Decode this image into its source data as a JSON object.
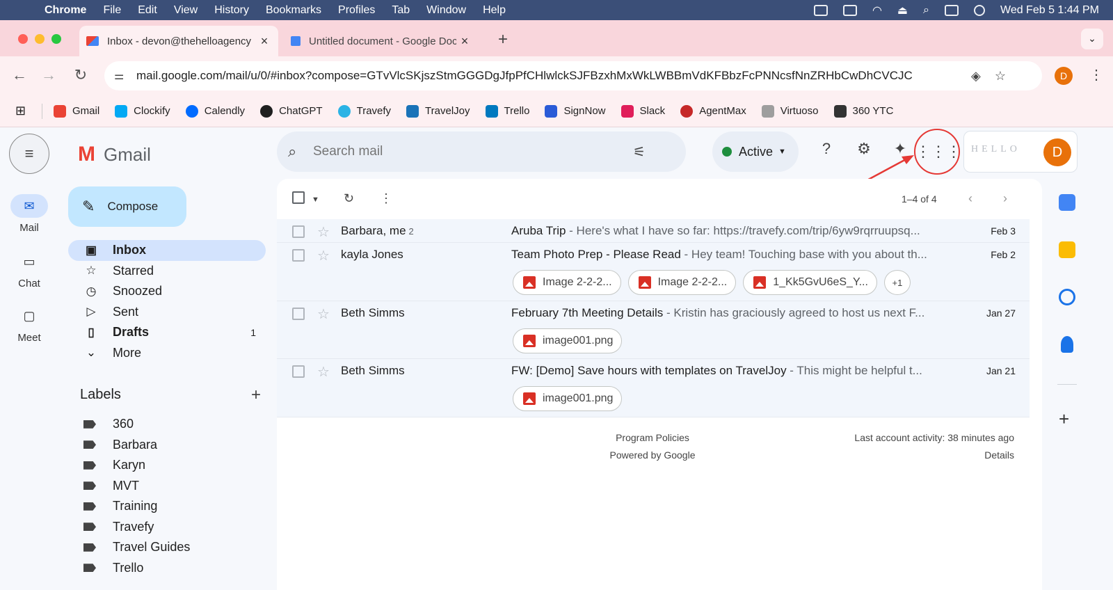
{
  "macos": {
    "app": "Chrome",
    "menus": [
      "File",
      "Edit",
      "View",
      "History",
      "Bookmarks",
      "Profiles",
      "Tab",
      "Window",
      "Help"
    ],
    "datetime": "Wed Feb 5  1:44 PM"
  },
  "tabs": [
    {
      "title": "Inbox - devon@thehelloagency",
      "icon": "gmail-icon"
    },
    {
      "title": "Untitled document - Google Docs",
      "icon": "docs-icon"
    }
  ],
  "browser": {
    "url": "mail.google.com/mail/u/0/#inbox?compose=GTvVlcSKjszStmGGGDgJfpPfCHlwlckSJFBzxhMxWkLWBBmVdKFBbzFcPNNcsfNnZRHbCwDhCVCJC",
    "profile_initial": "D"
  },
  "bookmarks": [
    {
      "label": "Gmail",
      "color": "#ea4335"
    },
    {
      "label": "Clockify",
      "color": "#03a9f4"
    },
    {
      "label": "Calendly",
      "color": "#006bff"
    },
    {
      "label": "ChatGPT",
      "color": "#1f1f1f"
    },
    {
      "label": "Travefy",
      "color": "#2bb3e5"
    },
    {
      "label": "TravelJoy",
      "color": "#1a73b8"
    },
    {
      "label": "Trello",
      "color": "#0079bf"
    },
    {
      "label": "SignNow",
      "color": "#2a5bd7"
    },
    {
      "label": "Slack",
      "color": "#e01e5a"
    },
    {
      "label": "AgentMax",
      "color": "#c62828"
    },
    {
      "label": "Virtuoso",
      "color": "#9e9e9e"
    },
    {
      "label": "360 YTC",
      "color": "#333333"
    }
  ],
  "rail": [
    {
      "label": "Mail",
      "icon": "mail-icon"
    },
    {
      "label": "Chat",
      "icon": "chat-icon"
    },
    {
      "label": "Meet",
      "icon": "video-icon"
    }
  ],
  "gmail": {
    "logo_text": "Gmail",
    "compose_label": "Compose",
    "search_placeholder": "Search mail",
    "status": "Active",
    "brand_text": "HELLO",
    "avatar_initial": "D"
  },
  "nav": [
    {
      "label": "Inbox",
      "icon": "inbox-icon",
      "count": ""
    },
    {
      "label": "Starred",
      "icon": "star-icon",
      "count": ""
    },
    {
      "label": "Snoozed",
      "icon": "clock-icon",
      "count": ""
    },
    {
      "label": "Sent",
      "icon": "send-icon",
      "count": ""
    },
    {
      "label": "Drafts",
      "icon": "draft-icon",
      "count": "1"
    },
    {
      "label": "More",
      "icon": "chevron-down-icon",
      "count": ""
    }
  ],
  "labels_heading": "Labels",
  "labels": [
    "360",
    "Barbara",
    "Karyn",
    "MVT",
    "Training",
    "Travefy",
    "Travel Guides",
    "Trello"
  ],
  "pagination": "1–4 of 4",
  "emails": [
    {
      "sender": "Barbara, me",
      "count": "2",
      "subject": "Aruba Trip",
      "preview": " - Here's what I have so far: https://travefy.com/trip/6yw9rqrruupsq...",
      "date": "Feb 3",
      "attachments": []
    },
    {
      "sender": "kayla Jones",
      "count": "",
      "subject": "Team Photo Prep - Please Read",
      "preview": " - Hey team! Touching base with you about th...",
      "date": "Feb 2",
      "attachments": [
        "Image 2-2-2...",
        "Image 2-2-2...",
        "1_Kk5GvU6eS_Y..."
      ],
      "more": "+1"
    },
    {
      "sender": "Beth Simms",
      "count": "",
      "subject": "February 7th Meeting Details",
      "preview": " - Kristin has graciously agreed to host us next F...",
      "date": "Jan 27",
      "attachments": [
        "image001.png"
      ]
    },
    {
      "sender": "Beth Simms",
      "count": "",
      "subject": "FW: [Demo] Save hours with templates on TravelJoy",
      "preview": " - This might be helpful t...",
      "date": "Jan 21",
      "attachments": [
        "image001.png"
      ]
    }
  ],
  "footer": {
    "policies": "Program Policies",
    "powered": "Powered by Google",
    "activity": "Last account activity: 38 minutes ago",
    "details": "Details"
  }
}
